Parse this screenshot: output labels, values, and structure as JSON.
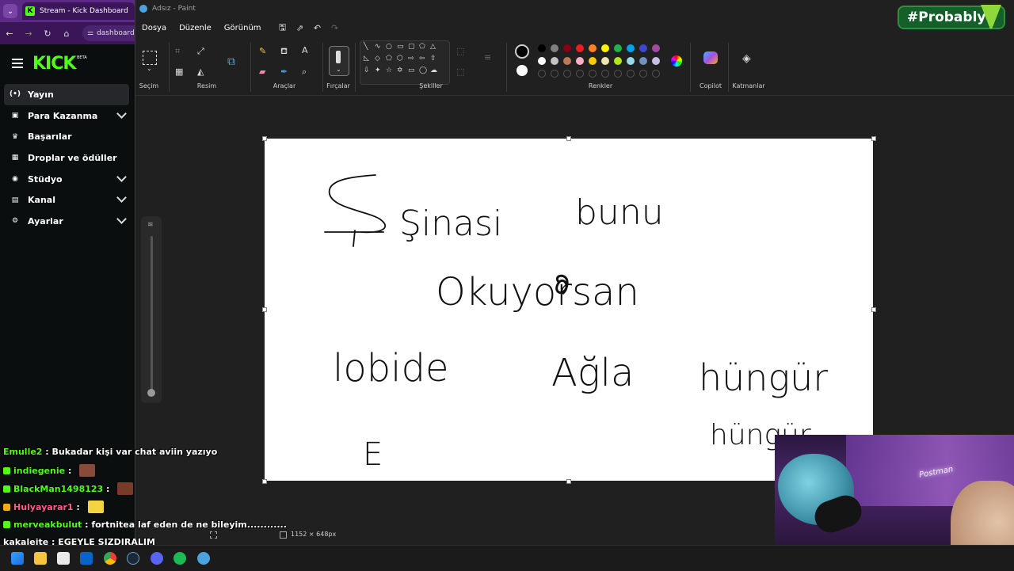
{
  "browser": {
    "tab_title": "Stream - Kick Dashboard",
    "url_text": "dashboard",
    "kick_logo": "KICK",
    "kick_beta": "BETA",
    "nav": [
      {
        "label": "Yayın",
        "icon": "broadcast-icon",
        "glyph": "(•)",
        "active": true,
        "expandable": false
      },
      {
        "label": "Para Kazanma",
        "icon": "monetization-icon",
        "glyph": "▣",
        "active": false,
        "expandable": true
      },
      {
        "label": "Başarılar",
        "icon": "trophy-icon",
        "glyph": "♛",
        "active": false,
        "expandable": false
      },
      {
        "label": "Droplar ve ödüller",
        "icon": "gift-icon",
        "glyph": "▦",
        "active": false,
        "expandable": false
      },
      {
        "label": "Stüdyo",
        "icon": "studio-icon",
        "glyph": "◉",
        "active": false,
        "expandable": true
      },
      {
        "label": "Kanal",
        "icon": "channel-icon",
        "glyph": "▤",
        "active": false,
        "expandable": true
      },
      {
        "label": "Ayarlar",
        "icon": "settings-icon",
        "glyph": "⚙",
        "active": false,
        "expandable": true
      }
    ]
  },
  "chat": [
    {
      "user": "Emulle2",
      "message": "Bukadar kişi var chat aviin yazıyo",
      "color": "#53fc18"
    },
    {
      "user": "indiegenie",
      "message": "",
      "color": "#53fc18",
      "emote": true
    },
    {
      "user": "BlackMan1498123",
      "message": "",
      "color": "#53fc18",
      "emote": true
    },
    {
      "user": "Hulyayarar1",
      "message": "",
      "color": "#ff5c8d",
      "emote": true
    },
    {
      "user": "merveakbulut",
      "message": "fortnitea laf eden de ne bileyim............",
      "color": "#53fc18"
    },
    {
      "user": "kakaleite",
      "message": "EGEYLE SIZDIRALIM",
      "color": "#ffffff"
    }
  ],
  "paint": {
    "window_title": "Adsız - Paint",
    "menu": [
      "Dosya",
      "Düzenle",
      "Görünüm"
    ],
    "groups": {
      "selection": "Seçim",
      "image": "Resim",
      "tools": "Araçlar",
      "brushes": "Fırçalar",
      "shapes": "Şekiller",
      "colors": "Renkler",
      "copilot": "Copilot",
      "layers": "Katmanlar"
    },
    "canvas_size": "1152 × 648px",
    "drawn_text": {
      "line1a": "Şinasi",
      "line1b": "bunu",
      "line2": "Okuyorsan",
      "line3a": "lobide",
      "line3b": "Ağla",
      "line3c": "hüngür",
      "line4a": "E",
      "line4b": "hüngür"
    },
    "palette": [
      "#000000",
      "#7f7f7f",
      "#880015",
      "#ed1c24",
      "#ff7f27",
      "#fff200",
      "#22b14c",
      "#00a2e8",
      "#3f48cc",
      "#a349a4",
      "#ffffff",
      "#c3c3c3",
      "#b97a57",
      "#ffaec9",
      "#ffc90e",
      "#efe4b0",
      "#b5e61d",
      "#99d9ea",
      "#7092be",
      "#c8bfe7"
    ],
    "primary_color": "#000000",
    "secondary_color": "#ffffff"
  },
  "overlay": {
    "hashtag": "#Probably",
    "webcam_sign": "Postman"
  }
}
